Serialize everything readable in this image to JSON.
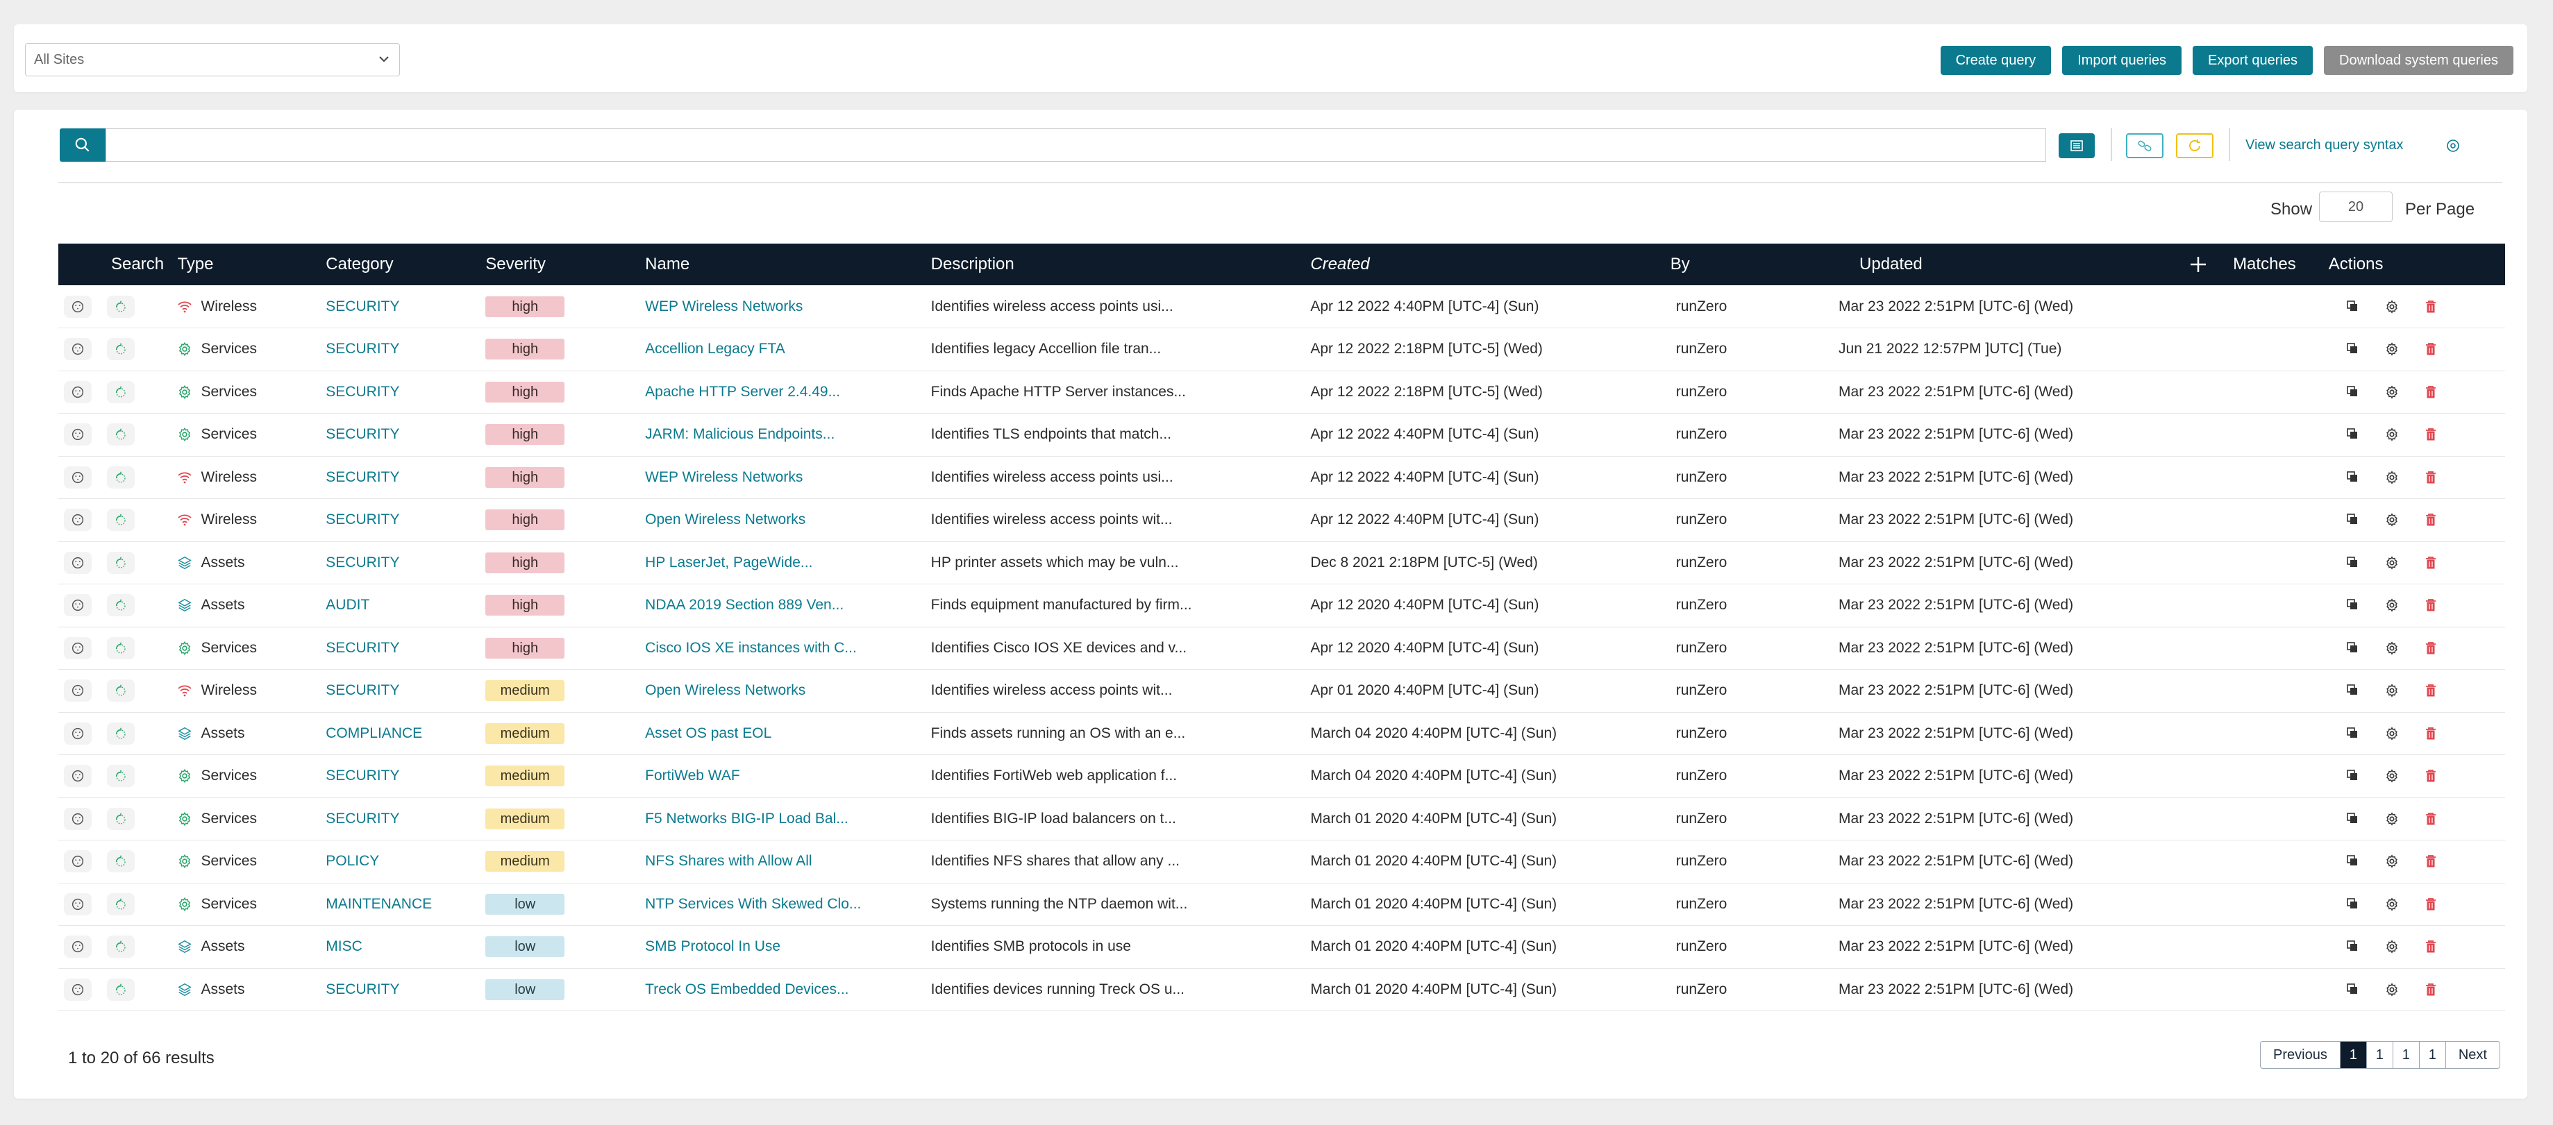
{
  "header": {
    "site_select": "All Sites",
    "buttons": [
      "Create query",
      "Import queries",
      "Export queries",
      "Download system queries"
    ]
  },
  "toolbar": {
    "search_value": "",
    "syntax_link": "View search query syntax",
    "show_label": "Show",
    "per_page_value": "20",
    "per_page_label": "Per Page"
  },
  "table": {
    "columns": [
      "Search",
      "Type",
      "Category",
      "Severity",
      "Name",
      "Description",
      "Created",
      "By",
      "Updated",
      "Matches",
      "Actions"
    ],
    "rows": [
      {
        "type": "Wireless",
        "type_icon": "wifi-icon",
        "category": "SECURITY",
        "severity": "high",
        "name": "WEP Wireless Networks",
        "description": "Identifies wireless access points usi...",
        "created": "Apr 12 2022 4:40PM [UTC-4] (Sun)",
        "by": "runZero",
        "updated": "Mar 23 2022 2:51PM [UTC-6] (Wed)"
      },
      {
        "type": "Services",
        "type_icon": "gear-icon",
        "category": "SECURITY",
        "severity": "high",
        "name": "Accellion Legacy FTA",
        "description": "Identifies legacy Accellion file tran...",
        "created": "Apr 12 2022 2:18PM [UTC-5] (Wed)",
        "by": "runZero",
        "updated": "Jun 21 2022 12:57PM ]UTC] (Tue)"
      },
      {
        "type": "Services",
        "type_icon": "gear-icon",
        "category": "SECURITY",
        "severity": "high",
        "name": "Apache HTTP Server 2.4.49...",
        "description": "Finds Apache HTTP Server instances...",
        "created": "Apr 12 2022 2:18PM [UTC-5] (Wed)",
        "by": "runZero",
        "updated": "Mar 23 2022 2:51PM [UTC-6] (Wed)"
      },
      {
        "type": "Services",
        "type_icon": "gear-icon",
        "category": "SECURITY",
        "severity": "high",
        "name": "JARM: Malicious Endpoints...",
        "description": "Identifies TLS endpoints that match...",
        "created": "Apr 12 2022 4:40PM [UTC-4] (Sun)",
        "by": "runZero",
        "updated": "Mar 23 2022 2:51PM [UTC-6] (Wed)"
      },
      {
        "type": "Wireless",
        "type_icon": "wifi-icon",
        "category": "SECURITY",
        "severity": "high",
        "name": "WEP Wireless Networks",
        "description": "Identifies wireless access points usi...",
        "created": "Apr 12 2022 4:40PM [UTC-4] (Sun)",
        "by": "runZero",
        "updated": "Mar 23 2022 2:51PM [UTC-6] (Wed)"
      },
      {
        "type": "Wireless",
        "type_icon": "wifi-icon",
        "category": "SECURITY",
        "severity": "high",
        "name": "Open Wireless Networks",
        "description": "Identifies wireless access points wit...",
        "created": "Apr 12 2022 4:40PM [UTC-4] (Sun)",
        "by": "runZero",
        "updated": "Mar 23 2022 2:51PM [UTC-6] (Wed)"
      },
      {
        "type": "Assets",
        "type_icon": "layers-icon",
        "category": "SECURITY",
        "severity": "high",
        "name": "HP LaserJet, PageWide...",
        "description": "HP printer assets which may be vuln...",
        "created": "Dec 8 2021 2:18PM [UTC-5] (Wed)",
        "by": "runZero",
        "updated": "Mar 23 2022 2:51PM [UTC-6] (Wed)"
      },
      {
        "type": "Assets",
        "type_icon": "layers-icon",
        "category": "AUDIT",
        "severity": "high",
        "name": "NDAA 2019 Section 889 Ven...",
        "description": "Finds equipment manufactured by firm...",
        "created": "Apr 12 2020 4:40PM [UTC-4] (Sun)",
        "by": "runZero",
        "updated": "Mar 23 2022 2:51PM [UTC-6] (Wed)"
      },
      {
        "type": "Services",
        "type_icon": "gear-icon",
        "category": "SECURITY",
        "severity": "high",
        "name": "Cisco IOS XE instances with C...",
        "description": "Identifies Cisco IOS XE devices and v...",
        "created": "Apr 12 2020 4:40PM [UTC-4] (Sun)",
        "by": "runZero",
        "updated": "Mar 23 2022 2:51PM [UTC-6] (Wed)"
      },
      {
        "type": "Wireless",
        "type_icon": "wifi-icon",
        "category": "SECURITY",
        "severity": "medium",
        "name": "Open Wireless Networks",
        "description": "Identifies wireless access points wit...",
        "created": "Apr 01 2020 4:40PM [UTC-4] (Sun)",
        "by": "runZero",
        "updated": "Mar 23 2022 2:51PM [UTC-6] (Wed)"
      },
      {
        "type": "Assets",
        "type_icon": "layers-icon",
        "category": "COMPLIANCE",
        "severity": "medium",
        "name": "Asset OS past EOL",
        "description": "Finds assets running an OS with an e...",
        "created": "March 04 2020 4:40PM [UTC-4] (Sun)",
        "by": "runZero",
        "updated": "Mar 23 2022 2:51PM [UTC-6] (Wed)"
      },
      {
        "type": "Services",
        "type_icon": "gear-icon",
        "category": "SECURITY",
        "severity": "medium",
        "name": "FortiWeb WAF",
        "description": "Identifies FortiWeb web application f...",
        "created": "March 04 2020 4:40PM [UTC-4] (Sun)",
        "by": "runZero",
        "updated": "Mar 23 2022 2:51PM [UTC-6] (Wed)"
      },
      {
        "type": "Services",
        "type_icon": "gear-icon",
        "category": "SECURITY",
        "severity": "medium",
        "name": "F5 Networks BIG-IP Load Bal...",
        "description": "Identifies BIG-IP load balancers on t...",
        "created": "March 01 2020 4:40PM [UTC-4] (Sun)",
        "by": "runZero",
        "updated": "Mar 23 2022 2:51PM [UTC-6] (Wed)"
      },
      {
        "type": "Services",
        "type_icon": "gear-icon",
        "category": "POLICY",
        "severity": "medium",
        "name": "NFS Shares with Allow All",
        "description": "Identifies NFS shares that allow any ...",
        "created": "March 01 2020 4:40PM [UTC-4] (Sun)",
        "by": "runZero",
        "updated": "Mar 23 2022 2:51PM [UTC-6] (Wed)"
      },
      {
        "type": "Services",
        "type_icon": "gear-icon",
        "category": "MAINTENANCE",
        "severity": "low",
        "name": "NTP Services With Skewed Clo...",
        "description": "Systems running the NTP daemon wit...",
        "created": "March 01 2020 4:40PM [UTC-4] (Sun)",
        "by": "runZero",
        "updated": "Mar 23 2022 2:51PM [UTC-6] (Wed)"
      },
      {
        "type": "Assets",
        "type_icon": "layers-icon",
        "category": "MISC",
        "severity": "low",
        "name": "SMB Protocol In Use",
        "description": "Identifies SMB protocols in use",
        "created": "March 01 2020 4:40PM [UTC-4] (Sun)",
        "by": "runZero",
        "updated": "Mar 23 2022 2:51PM [UTC-6] (Wed)"
      },
      {
        "type": "Assets",
        "type_icon": "layers-icon",
        "category": "SECURITY",
        "severity": "low",
        "name": "Treck OS Embedded Devices...",
        "description": "Identifies devices running Treck OS u...",
        "created": "March 01 2020 4:40PM [UTC-4] (Sun)",
        "by": "runZero",
        "updated": "Mar 23 2022 2:51PM [UTC-6] (Wed)"
      }
    ]
  },
  "footer": {
    "results": "1 to 20 of 66 results",
    "pagination": [
      "Previous",
      "1",
      "1",
      "1",
      "1",
      "Next"
    ]
  },
  "colors": {
    "accent": "#0b7a8f",
    "header_bg": "#0d1b2a",
    "wifi": "#e0464f",
    "gear": "#2aa76a",
    "layers": "#1e8fa0",
    "delete": "#e0464f"
  }
}
